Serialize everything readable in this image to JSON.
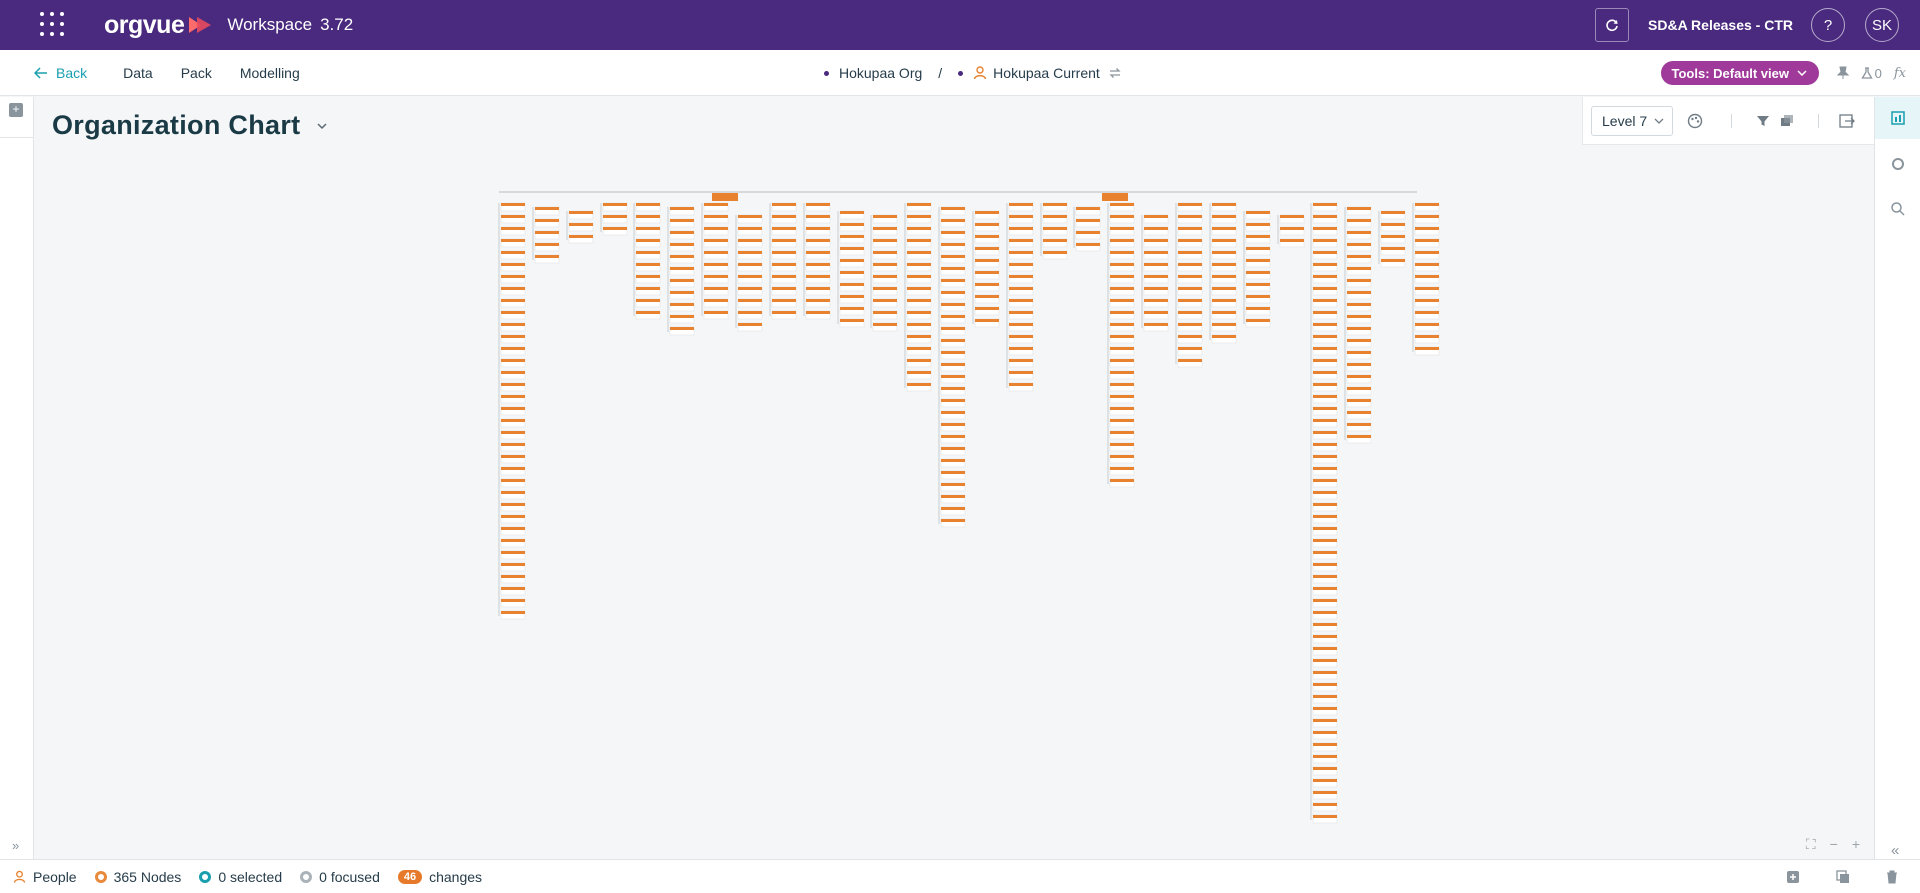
{
  "topbar": {
    "brand": "orgvue",
    "workspace_label": "Workspace",
    "workspace_version": "3.72",
    "release": "SD&A Releases - CTR",
    "help": "?",
    "avatar": "SK"
  },
  "nav": {
    "back": "Back",
    "items": [
      "Data",
      "Pack",
      "Modelling"
    ],
    "breadcrumb": {
      "org": "Hokupaa Org",
      "separator": "/",
      "view": "Hokupaa Current"
    },
    "tools_pill": "Tools: Default view",
    "user_count": "0"
  },
  "page": {
    "title": "Organization Chart",
    "level_select": "Level 7"
  },
  "status": {
    "people": "People",
    "nodes": "365 Nodes",
    "selected": "0 selected",
    "focused": "0 focused",
    "changes_count": "46",
    "changes_label": "changes"
  },
  "colors": {
    "topbar": "#4a2a7e",
    "accent_teal": "#1a9fb0",
    "node_orange": "#e8822e",
    "tools_pill": "#a03a9a"
  },
  "chart": {
    "columns_lengths": [
      35,
      5,
      3,
      3,
      10,
      11,
      10,
      10,
      10,
      10,
      10,
      10,
      16,
      27,
      10,
      16,
      5,
      4,
      24,
      10,
      14,
      12,
      10,
      3,
      52,
      20,
      5,
      13
    ]
  }
}
